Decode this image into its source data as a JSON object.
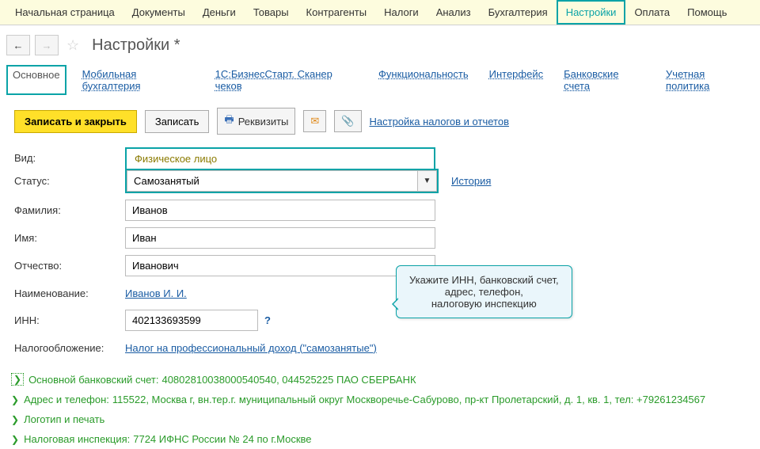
{
  "topnav": [
    "Начальная страница",
    "Документы",
    "Деньги",
    "Товары",
    "Контрагенты",
    "Налоги",
    "Анализ",
    "Бухгалтерия",
    "Настройки",
    "Оплата",
    "Помощь"
  ],
  "topnav_active_index": 8,
  "page_title": "Настройки *",
  "subtabs": [
    "Основное",
    "Мобильная бухгалтерия",
    "1С:БизнесСтарт. Сканер чеков",
    "Функциональность",
    "Интерфейс",
    "Банковские счета",
    "Учетная политика"
  ],
  "subtab_active_index": 0,
  "actions": {
    "save_close": "Записать и закрыть",
    "save": "Записать",
    "props": "Реквизиты",
    "tax_link": "Настройка налогов и отчетов"
  },
  "form": {
    "vid_label": "Вид:",
    "vid_value": "Физическое лицо",
    "status_label": "Статус:",
    "status_value": "Самозанятый",
    "history_link": "История",
    "lastname_label": "Фамилия:",
    "lastname_value": "Иванов",
    "firstname_label": "Имя:",
    "firstname_value": "Иван",
    "patronymic_label": "Отчество:",
    "patronymic_value": "Иванович",
    "naming_label": "Наименование:",
    "naming_link": "Иванов И. И.",
    "inn_label": "ИНН:",
    "inn_value": "402133693599",
    "tax_label": "Налогообложение:",
    "tax_link": "Налог на профессиональный доход (\"самозанятые\")"
  },
  "callout": {
    "line1": "Укажите ИНН, банковский счет,",
    "line2": "адрес, телефон,",
    "line3": "налоговую инспекцию"
  },
  "expand": [
    {
      "label": "Основной банковский счет:",
      "value": "40802810038000540540, 044525225 ПАО СБЕРБАНК",
      "boxed": true
    },
    {
      "label": "Адрес и телефон:",
      "value": "115522, Москва г, вн.тер.г. муниципальный округ Москворечье-Сабурово, пр-кт Пролетарский, д. 1, кв. 1, тел: +79261234567"
    },
    {
      "label": "Логотип и печать",
      "value": ""
    },
    {
      "label": "Налоговая инспекция:",
      "value": "7724 ИФНС России № 24 по г.Москве"
    }
  ]
}
